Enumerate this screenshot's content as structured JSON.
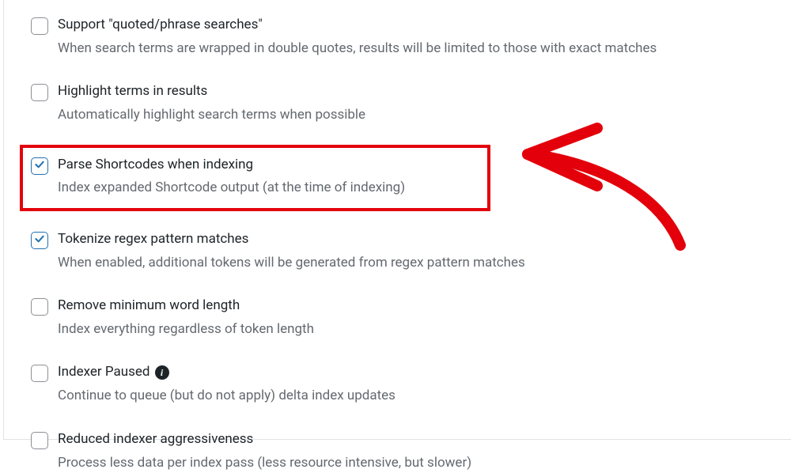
{
  "options": [
    {
      "id": "quoted-search",
      "checked": false,
      "label": "Support \"quoted/phrase searches\"",
      "desc": "When search terms are wrapped in double quotes, results will be limited to those with exact matches",
      "hasInfo": false
    },
    {
      "id": "highlight-terms",
      "checked": false,
      "label": "Highlight terms in results",
      "desc": "Automatically highlight search terms when possible",
      "hasInfo": false
    },
    {
      "id": "parse-shortcodes",
      "checked": true,
      "highlighted": true,
      "label": "Parse Shortcodes when indexing",
      "desc": "Index expanded Shortcode output (at the time of indexing)",
      "hasInfo": false
    },
    {
      "id": "tokenize-regex",
      "checked": true,
      "label": "Tokenize regex pattern matches",
      "desc": "When enabled, additional tokens will be generated from regex pattern matches",
      "hasInfo": false
    },
    {
      "id": "remove-min-word",
      "checked": false,
      "label": "Remove minimum word length",
      "desc": "Index everything regardless of token length",
      "hasInfo": false
    },
    {
      "id": "indexer-paused",
      "checked": false,
      "label": "Indexer Paused",
      "desc": "Continue to queue (but do not apply) delta index updates",
      "hasInfo": true
    },
    {
      "id": "reduced-aggressiveness",
      "checked": false,
      "label": "Reduced indexer aggressiveness",
      "desc": "Process less data per index pass (less resource intensive, but slower)",
      "hasInfo": false
    }
  ],
  "colors": {
    "highlight": "#e3000b",
    "check": "#2271b1"
  }
}
